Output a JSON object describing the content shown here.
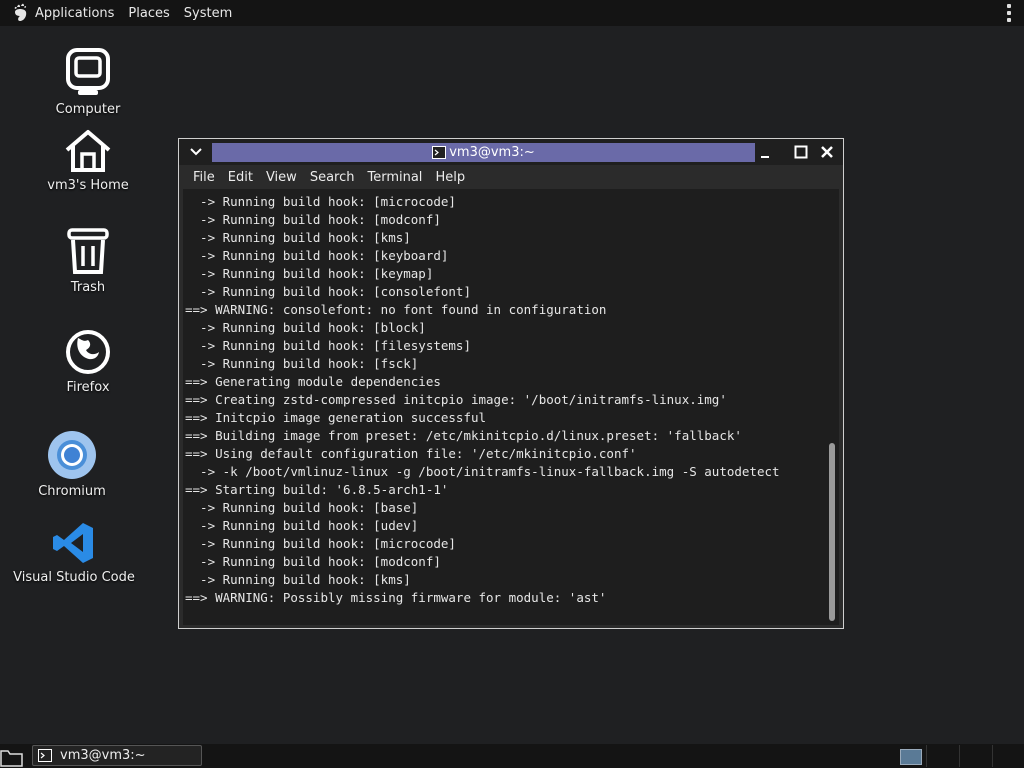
{
  "top_panel": {
    "menus": [
      "Applications",
      "Places",
      "System"
    ]
  },
  "desktop": {
    "icons": [
      {
        "label": "Computer",
        "icon": "computer-icon"
      },
      {
        "label": "vm3's Home",
        "icon": "home-folder-icon"
      },
      {
        "label": "Trash",
        "icon": "trash-icon"
      },
      {
        "label": "Firefox",
        "icon": "firefox-icon"
      },
      {
        "label": "Chromium",
        "icon": "chromium-icon"
      },
      {
        "label": "Visual Studio Code",
        "icon": "vscode-icon"
      }
    ]
  },
  "terminal": {
    "title": "vm3@vm3:~",
    "menu": [
      "File",
      "Edit",
      "View",
      "Search",
      "Terminal",
      "Help"
    ],
    "lines": [
      "  -> Running build hook: [microcode]",
      "  -> Running build hook: [modconf]",
      "  -> Running build hook: [kms]",
      "  -> Running build hook: [keyboard]",
      "  -> Running build hook: [keymap]",
      "  -> Running build hook: [consolefont]",
      "==> WARNING: consolefont: no font found in configuration",
      "  -> Running build hook: [block]",
      "  -> Running build hook: [filesystems]",
      "  -> Running build hook: [fsck]",
      "==> Generating module dependencies",
      "==> Creating zstd-compressed initcpio image: '/boot/initramfs-linux.img'",
      "==> Initcpio image generation successful",
      "==> Building image from preset: /etc/mkinitcpio.d/linux.preset: 'fallback'",
      "==> Using default configuration file: '/etc/mkinitcpio.conf'",
      "  -> -k /boot/vmlinuz-linux -g /boot/initramfs-linux-fallback.img -S autodetect",
      "==> Starting build: '6.8.5-arch1-1'",
      "  -> Running build hook: [base]",
      "  -> Running build hook: [udev]",
      "  -> Running build hook: [microcode]",
      "  -> Running build hook: [modconf]",
      "  -> Running build hook: [kms]",
      "==> WARNING: Possibly missing firmware for module: 'ast'"
    ]
  },
  "taskbar": {
    "task_label": "vm3@vm3:~"
  },
  "colors": {
    "title_highlight": "#6a6aa8",
    "chromium_blue": "#4a8fd8",
    "vscode_blue": "#2a8be6"
  }
}
